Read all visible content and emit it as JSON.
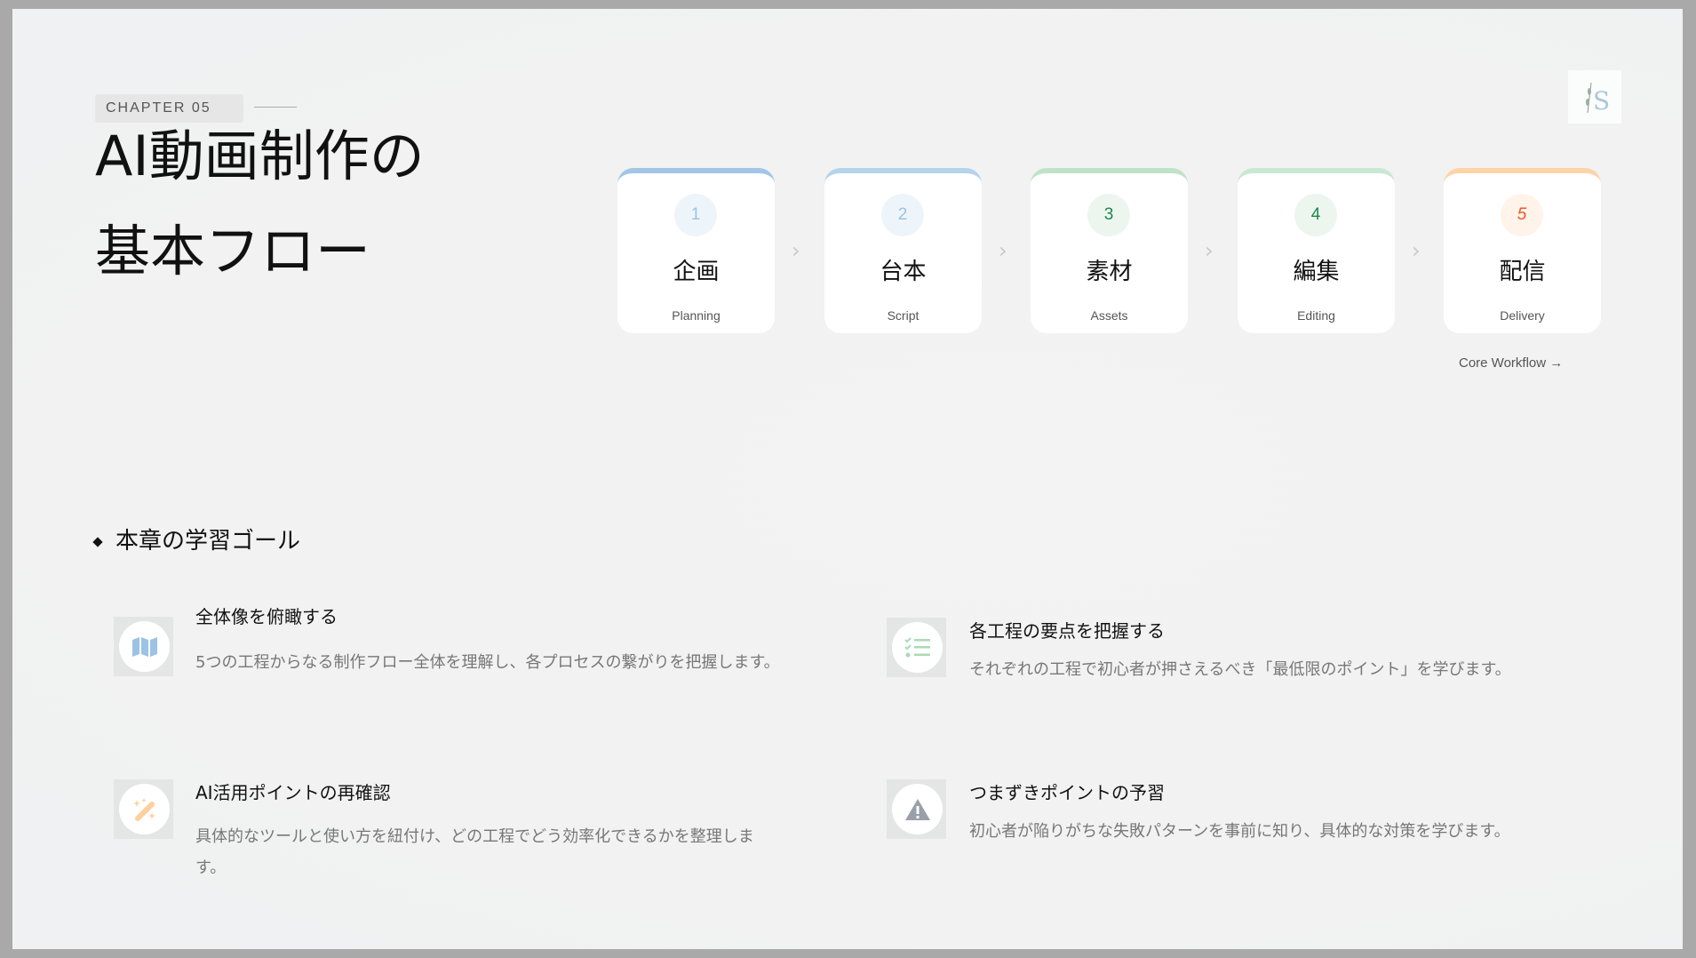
{
  "chapter": "CHAPTER 05",
  "title": {
    "line1": "AI動画制作の",
    "line2": "基本フロー"
  },
  "steps": [
    {
      "num": "1",
      "title": "企画",
      "sub": "Planning",
      "accent": "#a2c6e6",
      "num_color": "#9cc3e4",
      "circle_bg": "#eef5fa"
    },
    {
      "num": "2",
      "title": "台本",
      "sub": "Script",
      "accent": "#b5d3ea",
      "num_color": "#9cc3e4",
      "circle_bg": "#eef5fa"
    },
    {
      "num": "3",
      "title": "素材",
      "sub": "Assets",
      "accent": "#bfe3c8",
      "num_color": "#1a8a4a",
      "circle_bg": "#edf5ef"
    },
    {
      "num": "4",
      "title": "編集",
      "sub": "Editing",
      "accent": "#c9e8d2",
      "num_color": "#1a8a4a",
      "circle_bg": "#edf5ef"
    },
    {
      "num": "5",
      "title": "配信",
      "sub": "Delivery",
      "accent": "#ffd3a8",
      "num_color": "#f05a28",
      "circle_bg": "#fff3ea"
    }
  ],
  "core_workflow": "Core Workflow →",
  "goals_heading": "本章の学習ゴール",
  "goals": [
    {
      "icon": "map-icon",
      "title": "全体像を俯瞰する",
      "desc": "5つの工程からなる制作フロー全体を理解し、各プロセスの繋がりを把握します。"
    },
    {
      "icon": "checklist-icon",
      "title": "各工程の要点を把握する",
      "desc": "それぞれの工程で初心者が押さえるべき「最低限のポイント」を学びます。"
    },
    {
      "icon": "magic-wand-icon",
      "title": "AI活用ポイントの再確認",
      "desc": "具体的なツールと使い方を紐付け、どの工程でどう効率化できるかを整理します。"
    },
    {
      "icon": "warning-icon",
      "title": "つまずきポイントの予習",
      "desc": "初心者が陥りがちな失敗パターンを事前に知り、具体的な対策を学びます。"
    }
  ]
}
